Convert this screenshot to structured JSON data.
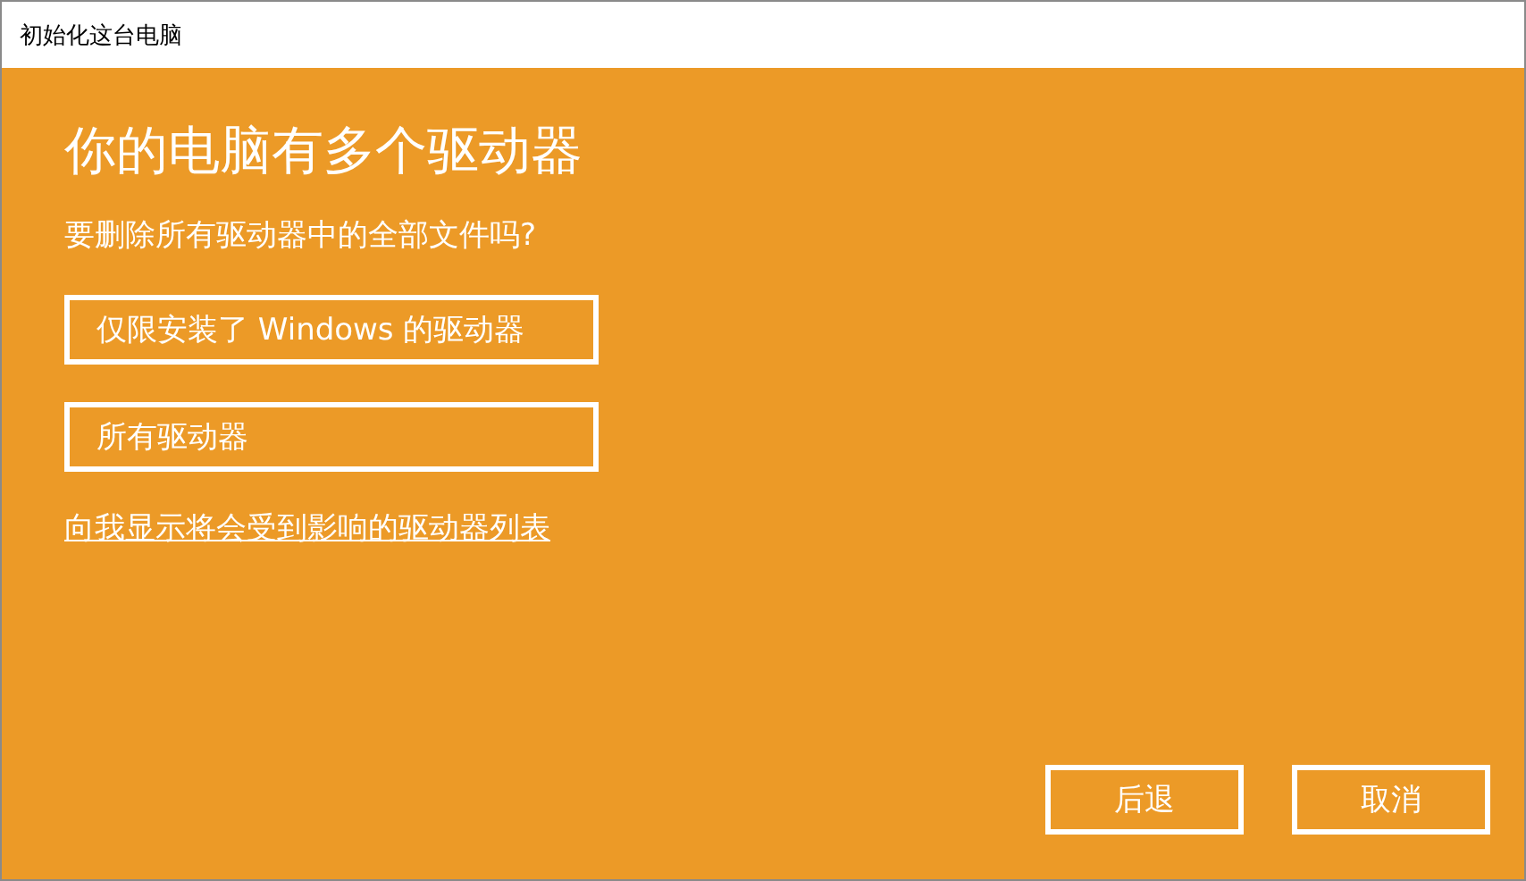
{
  "window": {
    "title": "初始化这台电脑"
  },
  "heading": "你的电脑有多个驱动器",
  "question": "要删除所有驱动器中的全部文件吗?",
  "options": [
    "仅限安装了 Windows 的驱动器",
    "所有驱动器"
  ],
  "link": "向我显示将会受到影响的驱动器列表",
  "buttons": [
    "后退",
    "取消"
  ]
}
